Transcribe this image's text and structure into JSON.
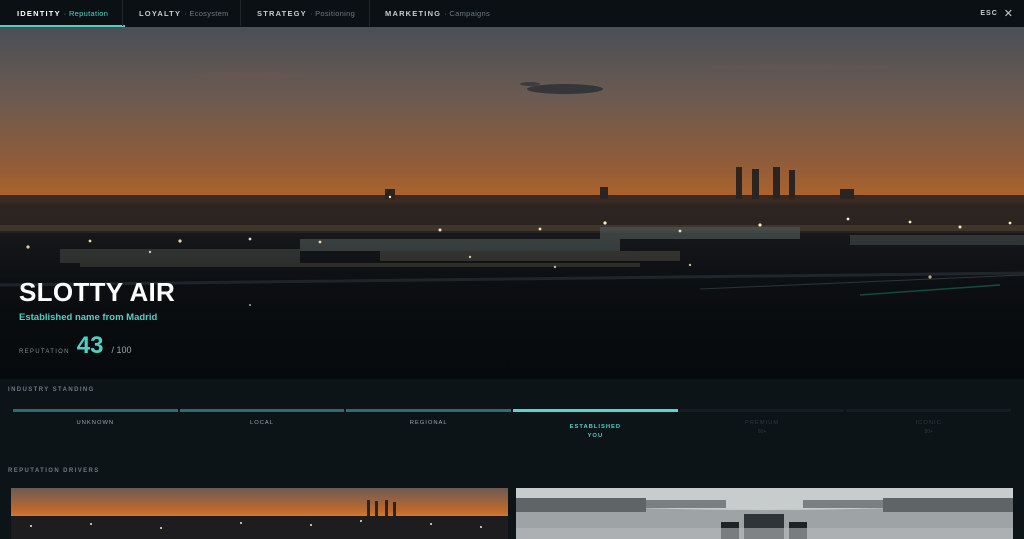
{
  "tabs": [
    {
      "label": "IDENTITY",
      "sub": "· Reputation",
      "active": true
    },
    {
      "label": "LOYALTY",
      "sub": "· Ecosystem",
      "active": false
    },
    {
      "label": "STRATEGY",
      "sub": "· Positioning",
      "active": false
    },
    {
      "label": "MARKETING",
      "sub": "· Campaigns",
      "active": false
    }
  ],
  "esc_label": "ESC",
  "close_glyph": "✕",
  "hero": {
    "airline_name": "SLOTTY AIR",
    "tagline": "Established name from Madrid",
    "reputation_label": "REPUTATION",
    "reputation_value": "43",
    "reputation_max": "/ 100"
  },
  "standing": {
    "section_label": "INDUSTRY STANDING",
    "tiers": [
      {
        "label": "UNKNOWN",
        "state": "reached"
      },
      {
        "label": "LOCAL",
        "state": "reached"
      },
      {
        "label": "REGIONAL",
        "state": "reached"
      },
      {
        "label": "ESTABLISHED",
        "state": "current",
        "marker": "YOU"
      },
      {
        "label": "PREMIUM",
        "state": "future",
        "threshold": "60+"
      },
      {
        "label": "ICONIC",
        "state": "future",
        "threshold": "80+"
      }
    ]
  },
  "drivers": {
    "section_label": "REPUTATION DRIVERS",
    "cards": [
      {
        "image": "madrid-skyline-dusk"
      },
      {
        "image": "aircraft-cabin-interior"
      }
    ]
  },
  "colors": {
    "accent": "#4fd0c3",
    "background": "#0d1418",
    "nav_background": "#0b1014"
  }
}
